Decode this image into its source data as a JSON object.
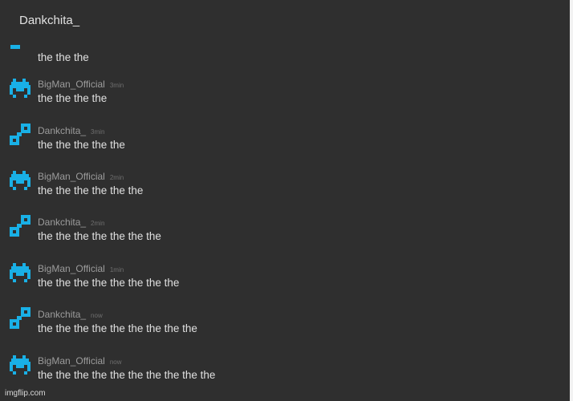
{
  "header": {
    "title": "Dankchita_"
  },
  "colors": {
    "background": "#2f2f2f",
    "avatar": "#19b0e6",
    "text": "#e0e0e0",
    "author": "#9c9c9c"
  },
  "messages": [
    {
      "author": "",
      "time": "",
      "text": "the the the",
      "avatar_icon": "dash-icon"
    },
    {
      "author": "BigMan_Official",
      "time": "3min",
      "text": "the the the the",
      "avatar_icon": "space-invader-icon"
    },
    {
      "author": "Dankchita_",
      "time": "3min",
      "text": "the the the the the",
      "avatar_icon": "pixel-link-icon"
    },
    {
      "author": "BigMan_Official",
      "time": "2min",
      "text": "the the the the the the",
      "avatar_icon": "space-invader-icon"
    },
    {
      "author": "Dankchita_",
      "time": "2min",
      "text": "the the the the the the the",
      "avatar_icon": "pixel-link-icon"
    },
    {
      "author": "BigMan_Official",
      "time": "1min",
      "text": "the the the the the the the the",
      "avatar_icon": "space-invader-icon"
    },
    {
      "author": "Dankchita_",
      "time": "now",
      "text": "the the the the the the the the the",
      "avatar_icon": "pixel-link-icon"
    },
    {
      "author": "BigMan_Official",
      "time": "now",
      "text": "the the the the the the the the the the",
      "avatar_icon": "space-invader-icon"
    }
  ],
  "watermark": "imgflip.com"
}
